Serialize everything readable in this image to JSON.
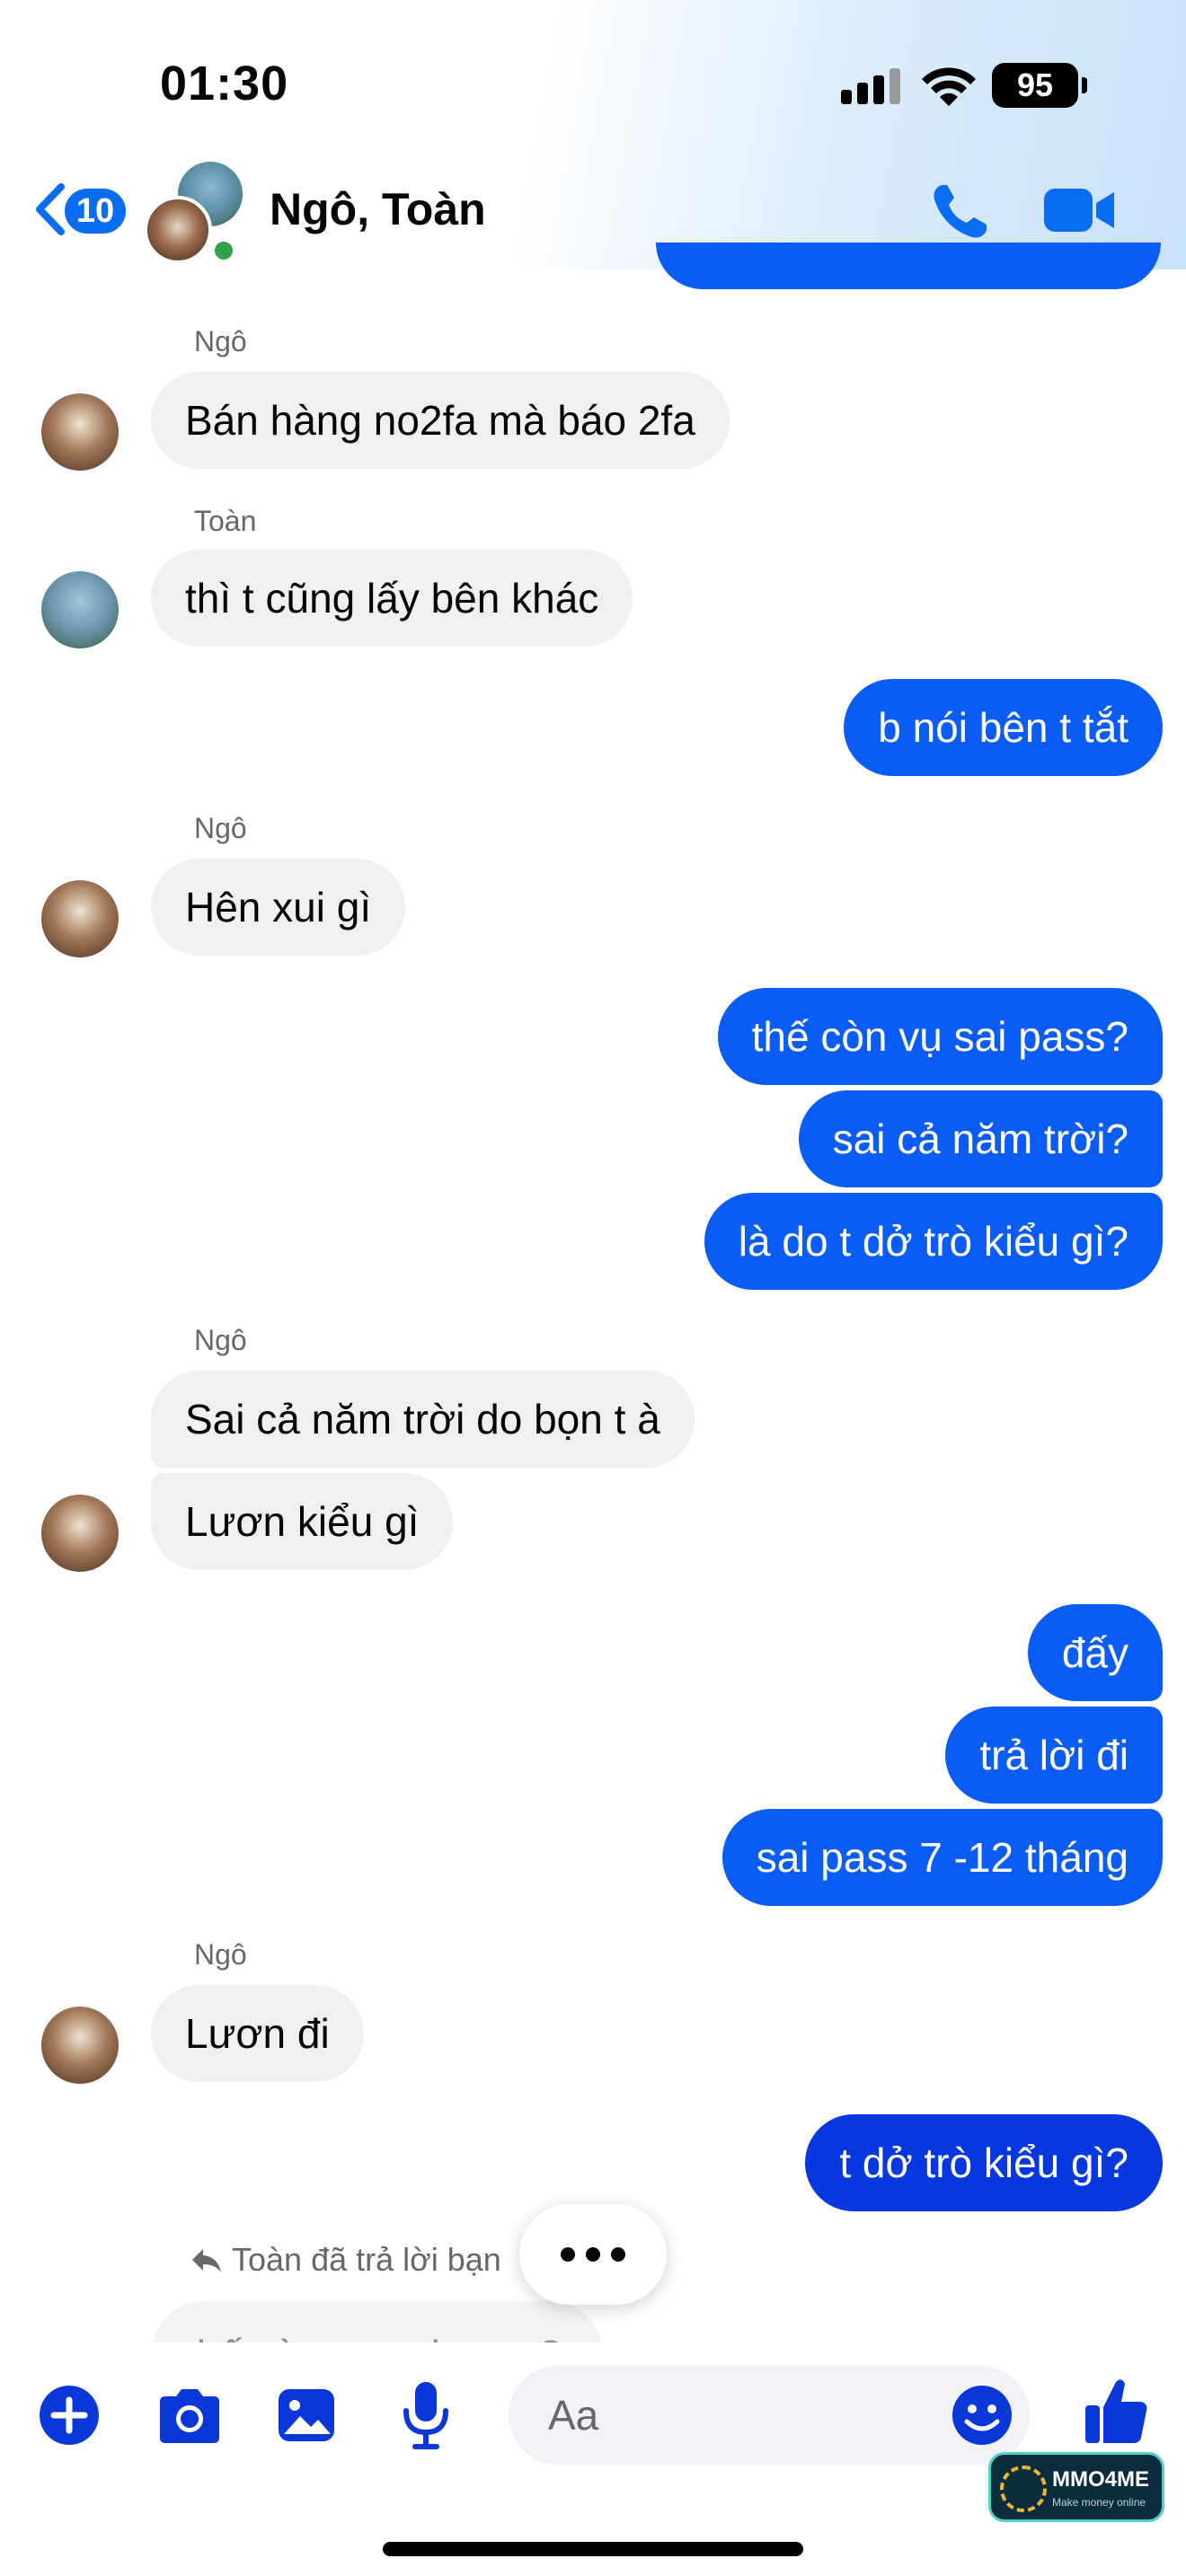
{
  "status_bar": {
    "time": "01:30",
    "battery": "95"
  },
  "header": {
    "back_count": "10",
    "title": "Ngô, Toàn"
  },
  "messages": {
    "m1_sender": "Ngô",
    "m1_text": "Bán hàng no2fa mà báo 2fa",
    "m2_sender": "Toàn",
    "m2_text": "thì t cũng lấy bên khác",
    "m3_text": "b nói bên t tắt",
    "m4_sender": "Ngô",
    "m4_text": "Hên xui gì",
    "m5_text": "thế còn vụ sai pass?",
    "m6_text": "sai cả năm trời?",
    "m7_text": "là do t dở trò kiểu gì?",
    "m8_sender": "Ngô",
    "m8_text": "Sai cả năm trời do bọn t à",
    "m9_text": "Lươn kiểu gì",
    "m10_text": "đấy",
    "m11_text": "trả lời đi",
    "m12_text": "sai pass 7 -12 tháng",
    "m13_sender": "Ngô",
    "m13_text": "Lươn đi",
    "m14_text": "t dở trò kiểu gì?",
    "reply_label": "Toàn đã trả lời bạn",
    "quoted_text": "thế còn vụ sai pass?"
  },
  "composer": {
    "placeholder": "Aa"
  },
  "watermark": {
    "brand": "MMO4ME",
    "tagline": "Make money online"
  },
  "colors": {
    "accent": "#0a5cf5",
    "accent_dark": "#0737df",
    "incoming": "#f0f0f0",
    "online": "#31a24c"
  },
  "icons": [
    "chevron-left-icon",
    "phone-icon",
    "video-camera-icon",
    "plus-icon",
    "camera-icon",
    "gallery-icon",
    "microphone-icon",
    "emoji-icon",
    "thumbs-up-icon",
    "reply-icon"
  ]
}
